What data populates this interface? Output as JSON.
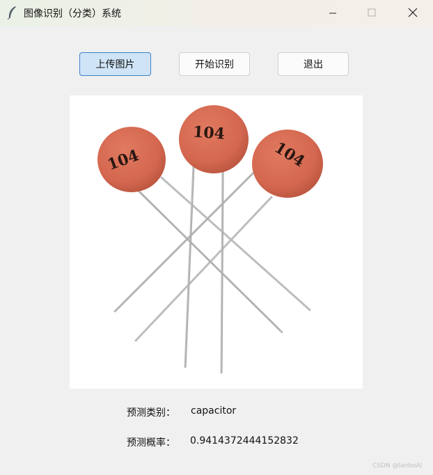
{
  "window": {
    "title": "图像识别（分类）系统",
    "icon": "feather-icon",
    "controls": [
      "minimize-icon",
      "maximize-icon",
      "close-icon"
    ]
  },
  "toolbar": {
    "upload_label": "上传图片",
    "start_label": "开始识别",
    "exit_label": "退出"
  },
  "image_preview": {
    "capacitor_markings": [
      "104",
      "104",
      "104"
    ],
    "colors": {
      "body": "#d4674f",
      "lead": "#bdbdbd",
      "print": "#2a1712"
    }
  },
  "result": {
    "class_label": "预测类别：",
    "class_value": "capacitor",
    "prob_label": "预测概率：",
    "prob_value": "0.9414372444152832"
  },
  "watermark": "CSDN @lanboAI",
  "colors": {
    "primary_button_bg": "#cfe4f7",
    "primary_button_border": "#3d7fc6",
    "window_bg": "#f0f0f0"
  }
}
